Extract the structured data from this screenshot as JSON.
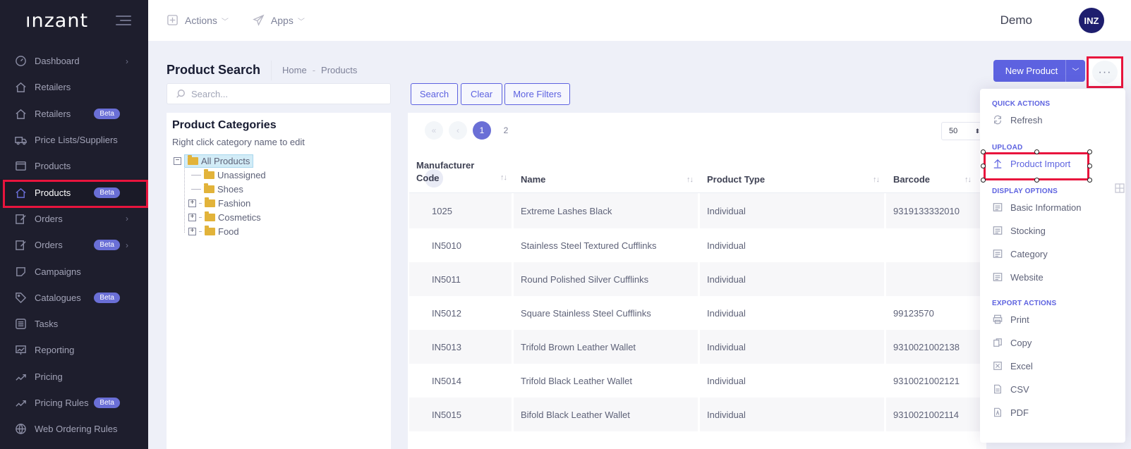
{
  "app": {
    "logo": "ınzant"
  },
  "header": {
    "menus": [
      {
        "label": "Actions",
        "icon": "plus-square-icon"
      },
      {
        "label": "Apps",
        "icon": "paper-plane-icon"
      }
    ],
    "user_name": "Demo",
    "avatar_initials": "INZ"
  },
  "sidebar": {
    "items": [
      {
        "label": "Dashboard",
        "icon": "dashboard-icon",
        "chevron": true
      },
      {
        "label": "Retailers",
        "icon": "home-icon"
      },
      {
        "label": "Retailers",
        "icon": "home-icon",
        "badge": "Beta"
      },
      {
        "label": "Price Lists/Suppliers",
        "icon": "truck-icon"
      },
      {
        "label": "Products",
        "icon": "box-icon"
      },
      {
        "label": "Products",
        "icon": "home-icon",
        "badge": "Beta",
        "active": true
      },
      {
        "label": "Orders",
        "icon": "edit-icon",
        "chevron": true
      },
      {
        "label": "Orders",
        "icon": "edit-icon",
        "badge": "Beta",
        "chevron": true
      },
      {
        "label": "Campaigns",
        "icon": "sticker-icon"
      },
      {
        "label": "Catalogues",
        "icon": "tag-icon",
        "badge": "Beta"
      },
      {
        "label": "Tasks",
        "icon": "list-icon"
      },
      {
        "label": "Reporting",
        "icon": "chart-icon"
      },
      {
        "label": "Pricing",
        "icon": "pricing-icon"
      },
      {
        "label": "Pricing Rules",
        "icon": "pricing-icon",
        "badge": "Beta"
      },
      {
        "label": "Web Ordering Rules",
        "icon": "globe-icon"
      }
    ]
  },
  "page": {
    "title": "Product Search",
    "breadcrumb": [
      "Home",
      "Products"
    ],
    "new_product_label": "New Product",
    "more_label": "···"
  },
  "search": {
    "placeholder": "Search...",
    "value": "",
    "search_label": "Search",
    "clear_label": "Clear",
    "more_filters_label": "More Filters"
  },
  "categories": {
    "title": "Product Categories",
    "hint": "Right click category name to edit",
    "root": "All Products",
    "children": [
      {
        "label": "Unassigned",
        "expandable": false
      },
      {
        "label": "Shoes",
        "expandable": false
      },
      {
        "label": "Fashion",
        "expandable": true
      },
      {
        "label": "Cosmetics",
        "expandable": true
      },
      {
        "label": "Food",
        "expandable": true
      }
    ]
  },
  "pagination": {
    "pages": [
      "1",
      "2"
    ],
    "current": "1",
    "per_page": "50",
    "prev_first": "«",
    "prev": "‹",
    "next": "›",
    "next_last": "»"
  },
  "table": {
    "columns": [
      {
        "label": "Manufacturer Code"
      },
      {
        "label": "Name"
      },
      {
        "label": "Product Type"
      },
      {
        "label": "Barcode"
      }
    ],
    "sort_glyph": "↑↓",
    "rows": [
      {
        "code": "1025",
        "name": "Extreme Lashes Black",
        "type": "Individual",
        "barcode": "9319133332010"
      },
      {
        "code": "IN5010",
        "name": "Stainless Steel Textured Cufflinks",
        "type": "Individual",
        "barcode": ""
      },
      {
        "code": "IN5011",
        "name": "Round Polished Silver Cufflinks",
        "type": "Individual",
        "barcode": ""
      },
      {
        "code": "IN5012",
        "name": "Square Stainless Steel Cufflinks",
        "type": "Individual",
        "barcode": "99123570"
      },
      {
        "code": "IN5013",
        "name": "Trifold Brown Leather Wallet",
        "type": "Individual",
        "barcode": "9310021002138"
      },
      {
        "code": "IN5014",
        "name": "Trifold Black Leather Wallet",
        "type": "Individual",
        "barcode": "9310021002121"
      },
      {
        "code": "IN5015",
        "name": "Bifold Black Leather Wallet",
        "type": "Individual",
        "barcode": "9310021002114"
      }
    ]
  },
  "dropdown": {
    "quick_actions_title": "QUICK ACTIONS",
    "refresh": "Refresh",
    "upload_title": "UPLOAD",
    "product_import": "Product Import",
    "display_title": "DISPLAY OPTIONS",
    "display_items": [
      "Basic Information",
      "Stocking",
      "Category",
      "Website"
    ],
    "export_title": "EXPORT ACTIONS",
    "export_items": [
      {
        "label": "Print",
        "icon": "printer-icon"
      },
      {
        "label": "Copy",
        "icon": "copy-icon"
      },
      {
        "label": "Excel",
        "icon": "excel-icon"
      },
      {
        "label": "CSV",
        "icon": "csv-file-icon"
      },
      {
        "label": "PDF",
        "icon": "pdf-file-icon"
      }
    ]
  },
  "colors": {
    "accent": "#5d62e0",
    "sidebar_bg": "#1e1e2d",
    "highlight": "#e8143d",
    "badge": "#6a6fd6"
  }
}
